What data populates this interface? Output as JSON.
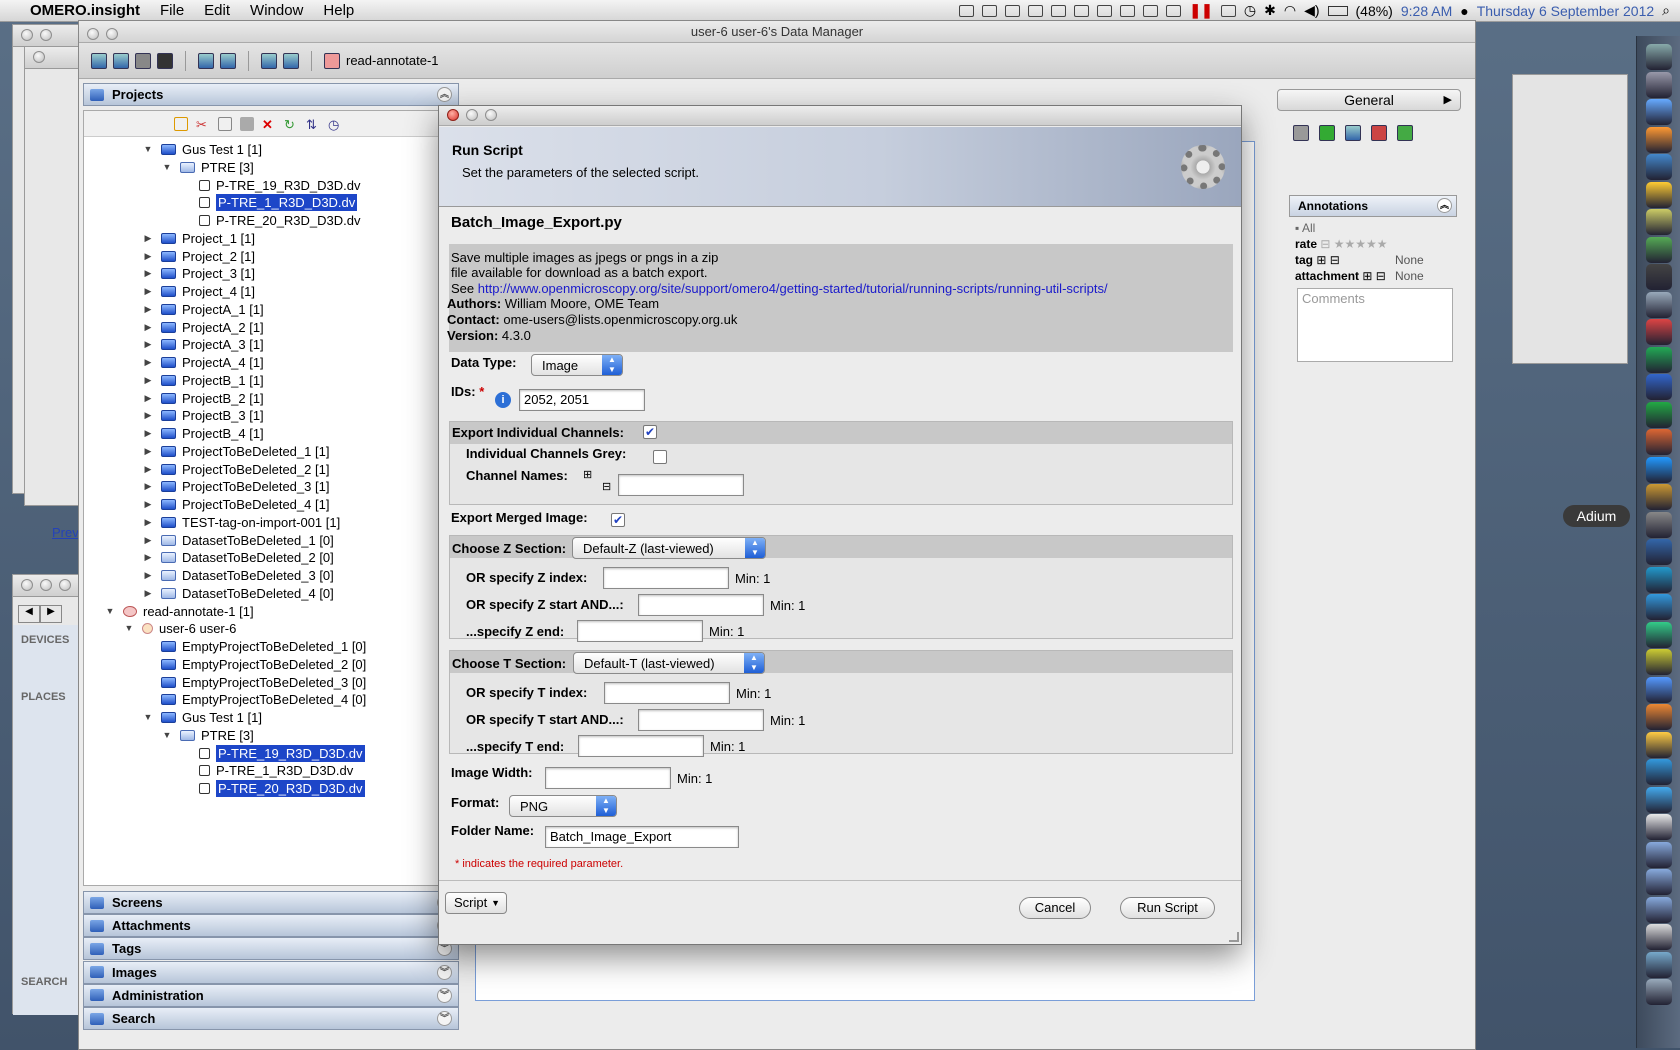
{
  "menubar": {
    "app": "OMERO.insight",
    "items": [
      "File",
      "Edit",
      "Window",
      "Help"
    ],
    "battery": "(48%)",
    "time": "9:28 AM",
    "date": "Thursday 6 September 2012"
  },
  "window": {
    "title": "user-6 user-6's Data Manager",
    "toolbar_group": "read-annotate-1"
  },
  "left": {
    "projects_header": "Projects",
    "tree": [
      {
        "label": "Gus Test 1 [1]",
        "type": "project",
        "arrow": "▼",
        "level": 1
      },
      {
        "label": "PTRE [3]",
        "type": "dataset",
        "arrow": "▼",
        "level": 2
      },
      {
        "label": "P-TRE_19_R3D_D3D.dv",
        "type": "image",
        "arrow": "",
        "level": 3
      },
      {
        "label": "P-TRE_1_R3D_D3D.dv",
        "type": "image",
        "arrow": "",
        "level": 3,
        "selected": true
      },
      {
        "label": "P-TRE_20_R3D_D3D.dv",
        "type": "image",
        "arrow": "",
        "level": 3
      },
      {
        "label": "Project_1 [1]",
        "type": "project",
        "arrow": "▶",
        "level": 1
      },
      {
        "label": "Project_2 [1]",
        "type": "project",
        "arrow": "▶",
        "level": 1
      },
      {
        "label": "Project_3 [1]",
        "type": "project",
        "arrow": "▶",
        "level": 1
      },
      {
        "label": "Project_4 [1]",
        "type": "project",
        "arrow": "▶",
        "level": 1
      },
      {
        "label": "ProjectA_1 [1]",
        "type": "project",
        "arrow": "▶",
        "level": 1
      },
      {
        "label": "ProjectA_2 [1]",
        "type": "project",
        "arrow": "▶",
        "level": 1
      },
      {
        "label": "ProjectA_3 [1]",
        "type": "project",
        "arrow": "▶",
        "level": 1
      },
      {
        "label": "ProjectA_4 [1]",
        "type": "project",
        "arrow": "▶",
        "level": 1
      },
      {
        "label": "ProjectB_1 [1]",
        "type": "project",
        "arrow": "▶",
        "level": 1
      },
      {
        "label": "ProjectB_2 [1]",
        "type": "project",
        "arrow": "▶",
        "level": 1
      },
      {
        "label": "ProjectB_3 [1]",
        "type": "project",
        "arrow": "▶",
        "level": 1
      },
      {
        "label": "ProjectB_4 [1]",
        "type": "project",
        "arrow": "▶",
        "level": 1
      },
      {
        "label": "ProjectToBeDeleted_1 [1]",
        "type": "project",
        "arrow": "▶",
        "level": 1
      },
      {
        "label": "ProjectToBeDeleted_2 [1]",
        "type": "project",
        "arrow": "▶",
        "level": 1
      },
      {
        "label": "ProjectToBeDeleted_3 [1]",
        "type": "project",
        "arrow": "▶",
        "level": 1
      },
      {
        "label": "ProjectToBeDeleted_4 [1]",
        "type": "project",
        "arrow": "▶",
        "level": 1
      },
      {
        "label": "TEST-tag-on-import-001 [1]",
        "type": "project",
        "arrow": "▶",
        "level": 1
      },
      {
        "label": "DatasetToBeDeleted_1 [0]",
        "type": "dataset",
        "arrow": "▶",
        "level": 1
      },
      {
        "label": "DatasetToBeDeleted_2 [0]",
        "type": "dataset",
        "arrow": "▶",
        "level": 1
      },
      {
        "label": "DatasetToBeDeleted_3 [0]",
        "type": "dataset",
        "arrow": "▶",
        "level": 1
      },
      {
        "label": "DatasetToBeDeleted_4 [0]",
        "type": "dataset",
        "arrow": "▶",
        "level": 1
      },
      {
        "label": "read-annotate-1 [1]",
        "type": "group",
        "arrow": "▼",
        "level": -1
      },
      {
        "label": "user-6 user-6",
        "type": "user",
        "arrow": "▼",
        "level": 0
      },
      {
        "label": "EmptyProjectToBeDeleted_1 [0]",
        "type": "project",
        "arrow": "",
        "level": 1
      },
      {
        "label": "EmptyProjectToBeDeleted_2 [0]",
        "type": "project",
        "arrow": "",
        "level": 1
      },
      {
        "label": "EmptyProjectToBeDeleted_3 [0]",
        "type": "project",
        "arrow": "",
        "level": 1
      },
      {
        "label": "EmptyProjectToBeDeleted_4 [0]",
        "type": "project",
        "arrow": "",
        "level": 1
      },
      {
        "label": "Gus Test 1 [1]",
        "type": "project",
        "arrow": "▼",
        "level": 1
      },
      {
        "label": "PTRE [3]",
        "type": "dataset",
        "arrow": "▼",
        "level": 2
      },
      {
        "label": "P-TRE_19_R3D_D3D.dv",
        "type": "image",
        "arrow": "",
        "level": 3,
        "selected": true
      },
      {
        "label": "P-TRE_1_R3D_D3D.dv",
        "type": "image",
        "arrow": "",
        "level": 3
      },
      {
        "label": "P-TRE_20_R3D_D3D.dv",
        "type": "image",
        "arrow": "",
        "level": 3,
        "selected": true
      }
    ],
    "sections": [
      "Screens",
      "Attachments",
      "Tags",
      "Images",
      "Administration",
      "Search"
    ]
  },
  "finder": {
    "devices_label": "DEVICES",
    "places_label": "PLACES",
    "search_label": "SEARCH",
    "preview_label": "Previ"
  },
  "right": {
    "general_tab": "General",
    "annotations_header": "Annotations",
    "all_label": "All",
    "rate_label": "rate",
    "tag_label": "tag",
    "tag_value": "None",
    "attachment_label": "attachment",
    "attachment_value": "None",
    "comments_placeholder": "Comments"
  },
  "dialog": {
    "header_title": "Run Script",
    "header_subtitle": "Set the parameters of the selected script.",
    "script_name": "Batch_Image_Export.py",
    "desc_line1": "Save multiple images as jpegs or pngs in a zip",
    "desc_line2": "file available for download as a batch export.",
    "desc_see": "See ",
    "desc_link": "http://www.openmicroscopy.org/site/support/omero4/getting-started/tutorial/running-scripts/running-util-scripts/",
    "authors_label": "Authors:",
    "authors": "William Moore, OME Team",
    "contact_label": "Contact:",
    "contact": "ome-users@lists.openmicroscopy.org.uk",
    "version_label": "Version:",
    "version": "4.3.0",
    "data_type_label": "Data Type:",
    "data_type_value": "Image",
    "ids_label": "IDs:",
    "ids_required": "*",
    "ids_value": "2052, 2051",
    "export_channels_label": "Export Individual Channels:",
    "export_channels_checked": true,
    "channels_grey_label": "Individual Channels Grey:",
    "channels_grey_checked": false,
    "channel_names_label": "Channel Names:",
    "export_merged_label": "Export Merged Image:",
    "export_merged_checked": true,
    "z_section_label": "Choose Z Section:",
    "z_section_value": "Default-Z (last-viewed)",
    "z_index_label": "OR specify Z index:",
    "z_start_label": "OR specify Z start AND...:",
    "z_end_label": "...specify Z end:",
    "t_section_label": "Choose T Section:",
    "t_section_value": "Default-T (last-viewed)",
    "t_index_label": "OR specify T index:",
    "t_start_label": "OR specify T start AND...:",
    "t_end_label": "...specify T end:",
    "min_label": "Min: 1",
    "image_width_label": "Image Width:",
    "format_label": "Format:",
    "format_value": "PNG",
    "folder_label": "Folder Name:",
    "folder_value": "Batch_Image_Export",
    "required_note": "* indicates the required parameter.",
    "script_menu": "Script",
    "cancel": "Cancel",
    "run": "Run Script"
  },
  "dock": {
    "tooltip": "Adium"
  }
}
